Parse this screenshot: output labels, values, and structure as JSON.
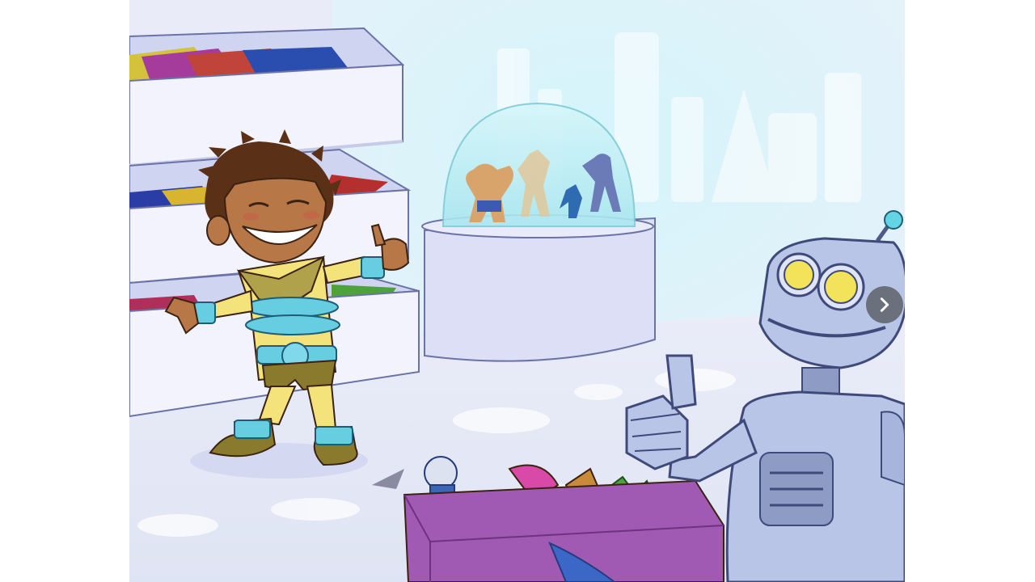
{
  "scene": {
    "description_label": "",
    "icons": {
      "next": "chevron-right-icon"
    },
    "colors": {
      "room_bg": "#eef0fb",
      "window_glow": "#d8f2fb",
      "floor": "#e6e9f7",
      "shelf": "#f1f2fb",
      "toy_box": "#a15ab3",
      "robot": "#b9c5e6",
      "robot_eyes": "#f3e35a",
      "costume": "#f4e27a",
      "costume_bands": "#67cde0",
      "dome": "#bfeef4",
      "nav_button": "#3c3c3c"
    }
  }
}
